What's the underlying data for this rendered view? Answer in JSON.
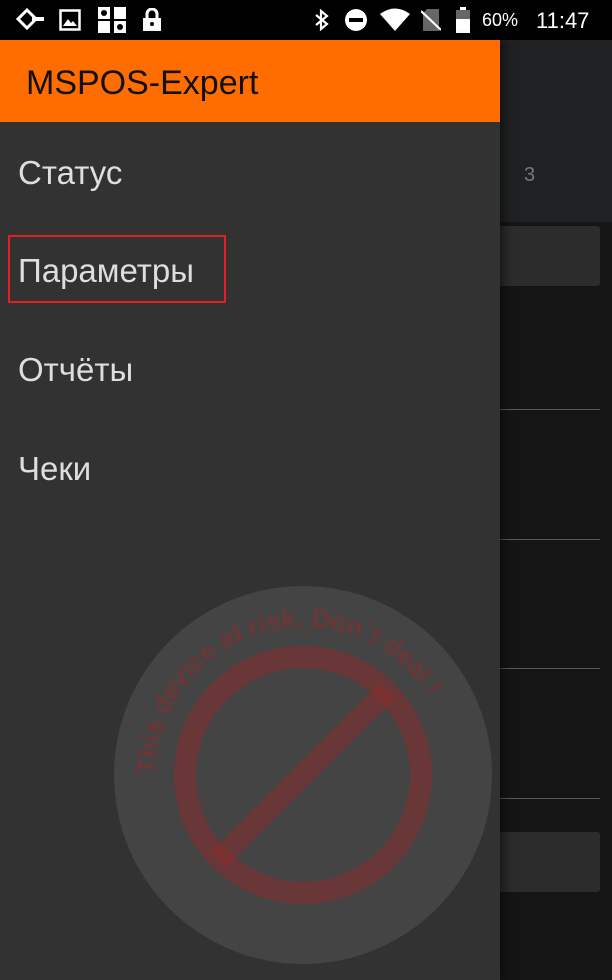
{
  "status_bar": {
    "battery_percent": "60%",
    "time": "11:47",
    "icons": [
      "notification-diamond-icon",
      "gallery-icon",
      "app-grid-icon",
      "lock-icon",
      "bluetooth-icon",
      "do-not-disturb-icon",
      "wifi-icon",
      "no-sim-icon",
      "battery-icon"
    ]
  },
  "background_app": {
    "tab_label": "3"
  },
  "drawer": {
    "title": "MSPOS-Expert",
    "items": [
      {
        "label": "Статус"
      },
      {
        "label": "Параметры"
      },
      {
        "label": "Отчёты"
      },
      {
        "label": "Чеки"
      }
    ],
    "highlight_color": "#e51e25",
    "header_color": "#ff6d00"
  },
  "watermark": {
    "text": "This device at risk. Don`t deal !"
  }
}
